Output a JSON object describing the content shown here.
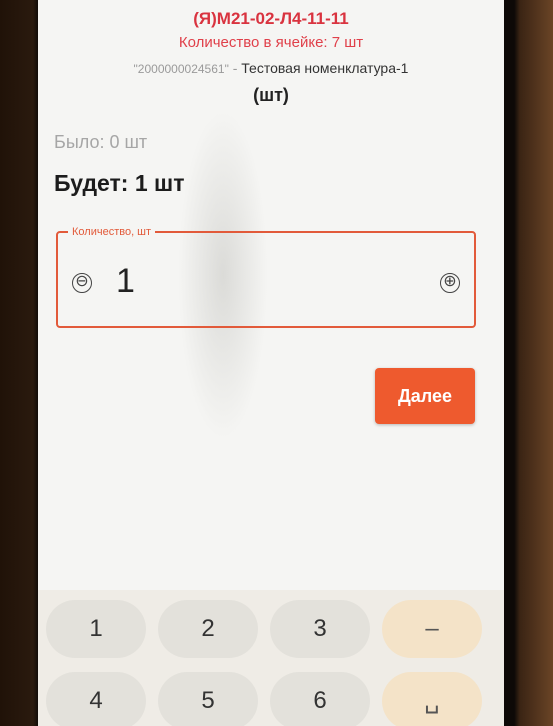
{
  "header": {
    "cell_code": "(Я)М21-02-Л4-11-11",
    "cell_quantity": "Количество в ячейке: 7 шт",
    "barcode": "\"2000000024561\"",
    "separator": " - ",
    "product_name": "Тестовая номенклатура-1",
    "unit": "(шт)"
  },
  "counts": {
    "was": "Было: 0 шт",
    "will_be": "Будет: 1 шт"
  },
  "quantity_field": {
    "legend": "Количество, шт",
    "value": "1",
    "minus_icon": "⊖",
    "plus_icon": "⊕"
  },
  "actions": {
    "next_label": "Далее"
  },
  "keyboard": {
    "keys": [
      "1",
      "2",
      "3",
      "–",
      "4",
      "5",
      "6",
      "␣"
    ]
  },
  "colors": {
    "accent": "#ee5a2e",
    "cell_code": "#d9333f",
    "field_border": "#e25a3a"
  }
}
